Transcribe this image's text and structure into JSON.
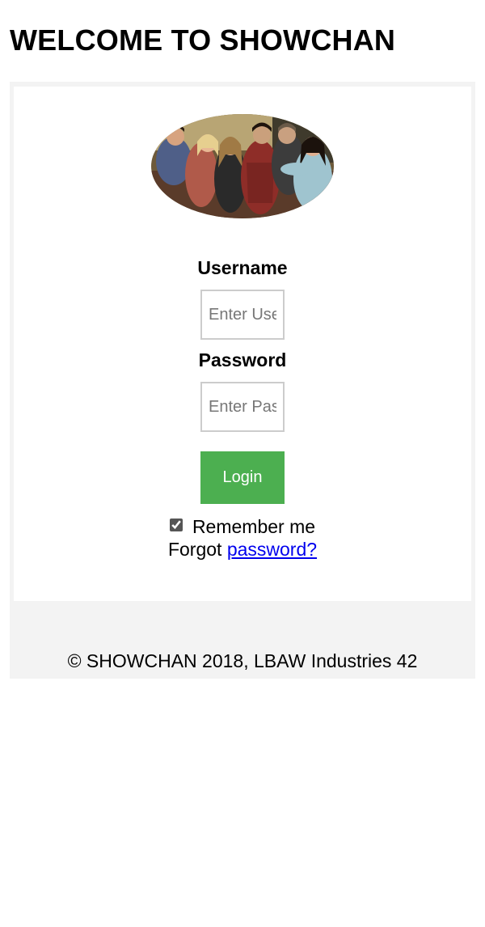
{
  "page": {
    "title": "WELCOME TO SHOWCHAN"
  },
  "login": {
    "username_label": "Username",
    "username_placeholder": "Enter Username",
    "password_label": "Password",
    "password_placeholder": "Enter Password",
    "login_button": "Login",
    "remember_label": "Remember me",
    "remember_checked": true,
    "forgot_prefix": "Forgot",
    "forgot_link": "password?"
  },
  "footer": {
    "text": "© SHOWCHAN 2018, LBAW Industries 42"
  },
  "colors": {
    "login_button_bg": "#4caf50",
    "panel_bg": "#f3f3f3",
    "link": "#0000ee"
  }
}
